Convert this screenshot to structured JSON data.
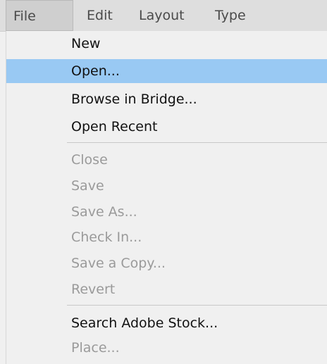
{
  "menubar": {
    "items": [
      {
        "label": "File"
      },
      {
        "label": "Edit"
      },
      {
        "label": "Layout"
      },
      {
        "label": "Type"
      }
    ]
  },
  "file_menu": {
    "groups": [
      [
        {
          "label": "New",
          "enabled": true
        },
        {
          "label": "Open...",
          "enabled": true,
          "highlighted": true
        },
        {
          "label": "Browse in Bridge...",
          "enabled": true
        },
        {
          "label": "Open Recent",
          "enabled": true
        }
      ],
      [
        {
          "label": "Close",
          "enabled": false
        },
        {
          "label": "Save",
          "enabled": false
        },
        {
          "label": "Save As...",
          "enabled": false
        },
        {
          "label": "Check In...",
          "enabled": false
        },
        {
          "label": "Save a Copy...",
          "enabled": false
        },
        {
          "label": "Revert",
          "enabled": false
        }
      ],
      [
        {
          "label": "Search Adobe Stock...",
          "enabled": true
        },
        {
          "label": "Place...",
          "enabled": false
        }
      ]
    ]
  },
  "colors": {
    "highlight": "#99c9f3",
    "menubar_bg": "#dedede",
    "menu_bg": "#f0f0f0",
    "enabled_text": "#111111",
    "disabled_text": "#9a9a9a"
  }
}
